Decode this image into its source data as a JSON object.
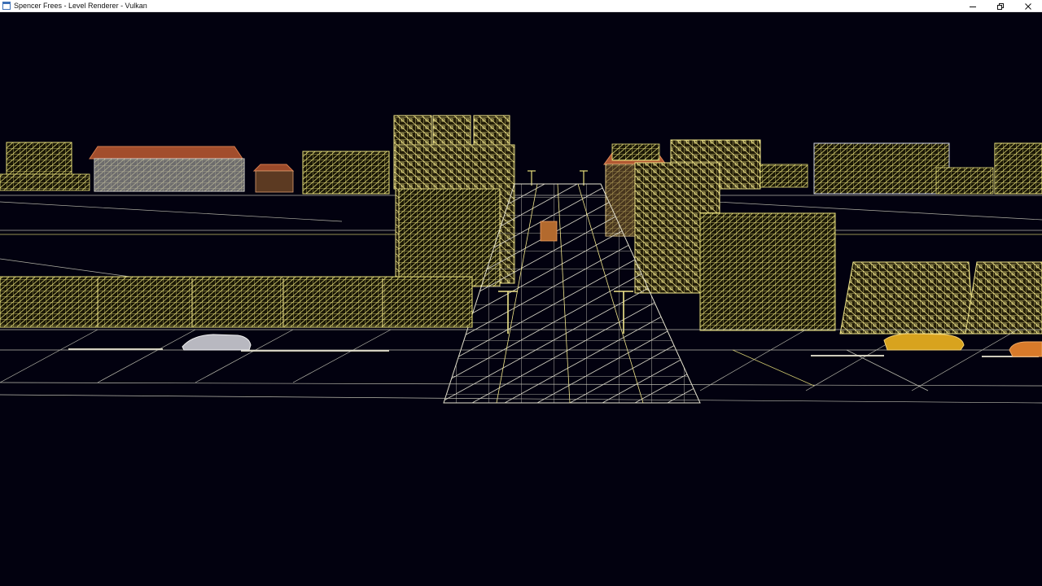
{
  "window": {
    "title": "Spencer Frees - Level Renderer - Vulkan",
    "icon": "app-window-icon",
    "controls": [
      {
        "name": "minimize",
        "icon": "minimize-icon"
      },
      {
        "name": "restore",
        "icon": "restore-icon"
      },
      {
        "name": "close",
        "icon": "close-icon"
      }
    ]
  },
  "scene": {
    "render_mode": "wireframe",
    "background_color": "#02010f",
    "wire_color_primary": "#e8e07a",
    "wire_color_secondary": "#cfd3e6",
    "accent_color": "#c86b3a"
  }
}
